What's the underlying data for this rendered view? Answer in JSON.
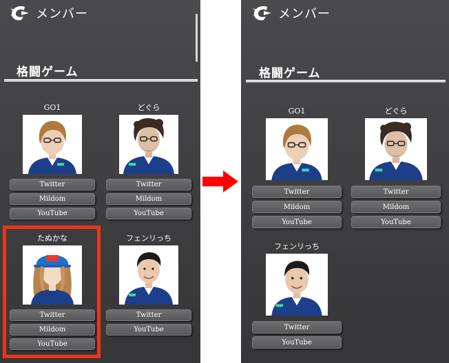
{
  "colors": {
    "panel_bg": "#434345",
    "highlight": "#e8361a",
    "arrow": "#ff0000",
    "button_bg": "#636365"
  },
  "left": {
    "header": {
      "title": "メンバー",
      "logo_icon": "cyclops-logo-icon"
    },
    "section_title": "格闘ゲーム",
    "members": [
      {
        "name": "GO1",
        "links": [
          "Twitter",
          "Mildom",
          "YouTube"
        ]
      },
      {
        "name": "どぐら",
        "links": [
          "Twitter",
          "Mildom",
          "YouTube"
        ]
      },
      {
        "name": "たぬかな",
        "links": [
          "Twitter",
          "Mildom",
          "YouTube"
        ]
      },
      {
        "name": "フェンリっち",
        "links": [
          "Twitter",
          "YouTube"
        ]
      }
    ]
  },
  "right": {
    "header": {
      "title": "メンバー",
      "logo_icon": "cyclops-logo-icon"
    },
    "section_title": "格闘ゲーム",
    "members": [
      {
        "name": "GO1",
        "links": [
          "Twitter",
          "Mildom",
          "YouTube"
        ]
      },
      {
        "name": "どぐら",
        "links": [
          "Twitter",
          "Mildom",
          "YouTube"
        ]
      },
      {
        "name": "フェンリっち",
        "links": [
          "Twitter",
          "YouTube"
        ]
      }
    ]
  },
  "annotations": {
    "highlighted_member": "たぬかな",
    "arrow_icon": "right-arrow-icon"
  }
}
